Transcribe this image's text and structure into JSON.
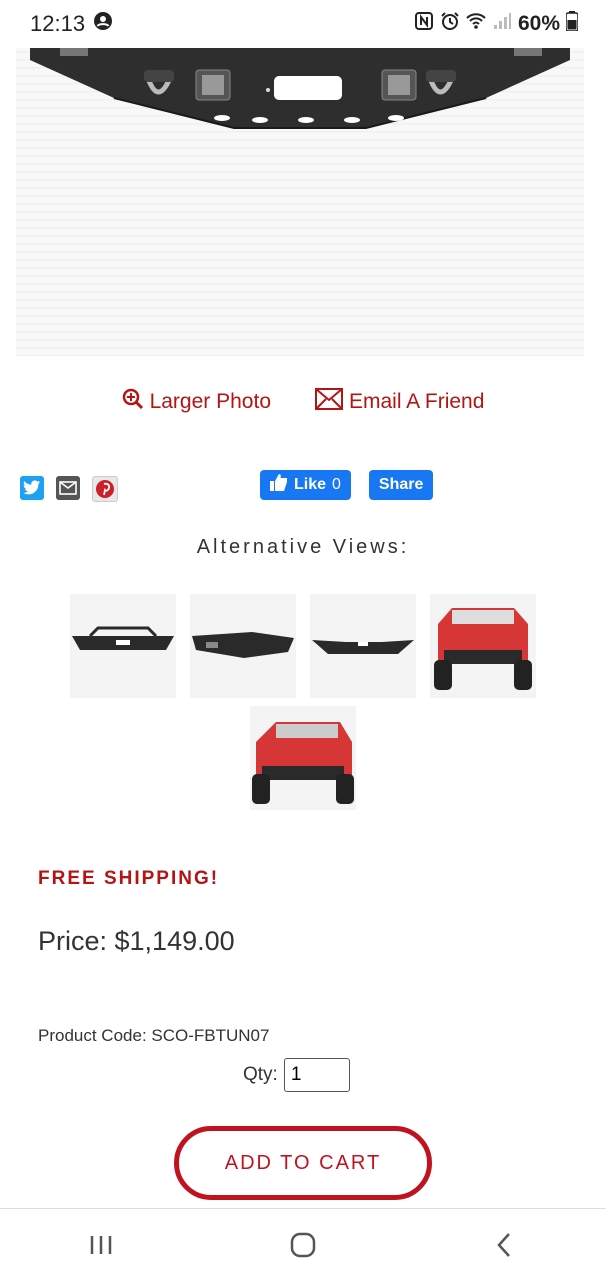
{
  "status_bar": {
    "time": "12:13",
    "battery": "60%"
  },
  "links": {
    "larger_photo": "Larger Photo",
    "email_friend": "Email A Friend"
  },
  "social": {
    "like_label": "Like",
    "like_count": "0",
    "share_label": "Share"
  },
  "alternative_views": {
    "title": "Alternative Views:"
  },
  "product": {
    "free_shipping": "FREE SHIPPING!",
    "price": "Price: $1,149.00",
    "product_code": "Product Code: SCO-FBTUN07",
    "qty_label": "Qty:",
    "qty_value": "1",
    "add_to_cart": "ADD TO CART"
  },
  "colors": {
    "accent_red": "#c1121f",
    "link_red": "#b51414",
    "facebook_blue": "#1877f2"
  }
}
